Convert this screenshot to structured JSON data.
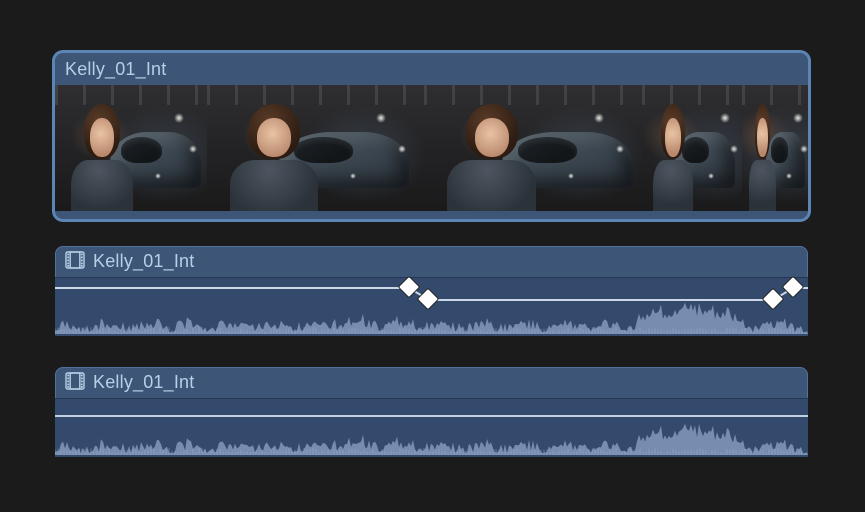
{
  "clips": {
    "video": {
      "name": "Kelly_01_Int"
    },
    "audio1": {
      "name": "Kelly_01_Int"
    },
    "audio2": {
      "name": "Kelly_01_Int"
    }
  },
  "keyframes_audio1": [
    {
      "x_pct": 47.0,
      "level": "high"
    },
    {
      "x_pct": 49.6,
      "level": "low"
    },
    {
      "x_pct": 95.4,
      "level": "low"
    },
    {
      "x_pct": 98.0,
      "level": "high"
    }
  ],
  "volume_line_audio1": {
    "high_y_pct": 16,
    "low_y_pct": 36
  }
}
